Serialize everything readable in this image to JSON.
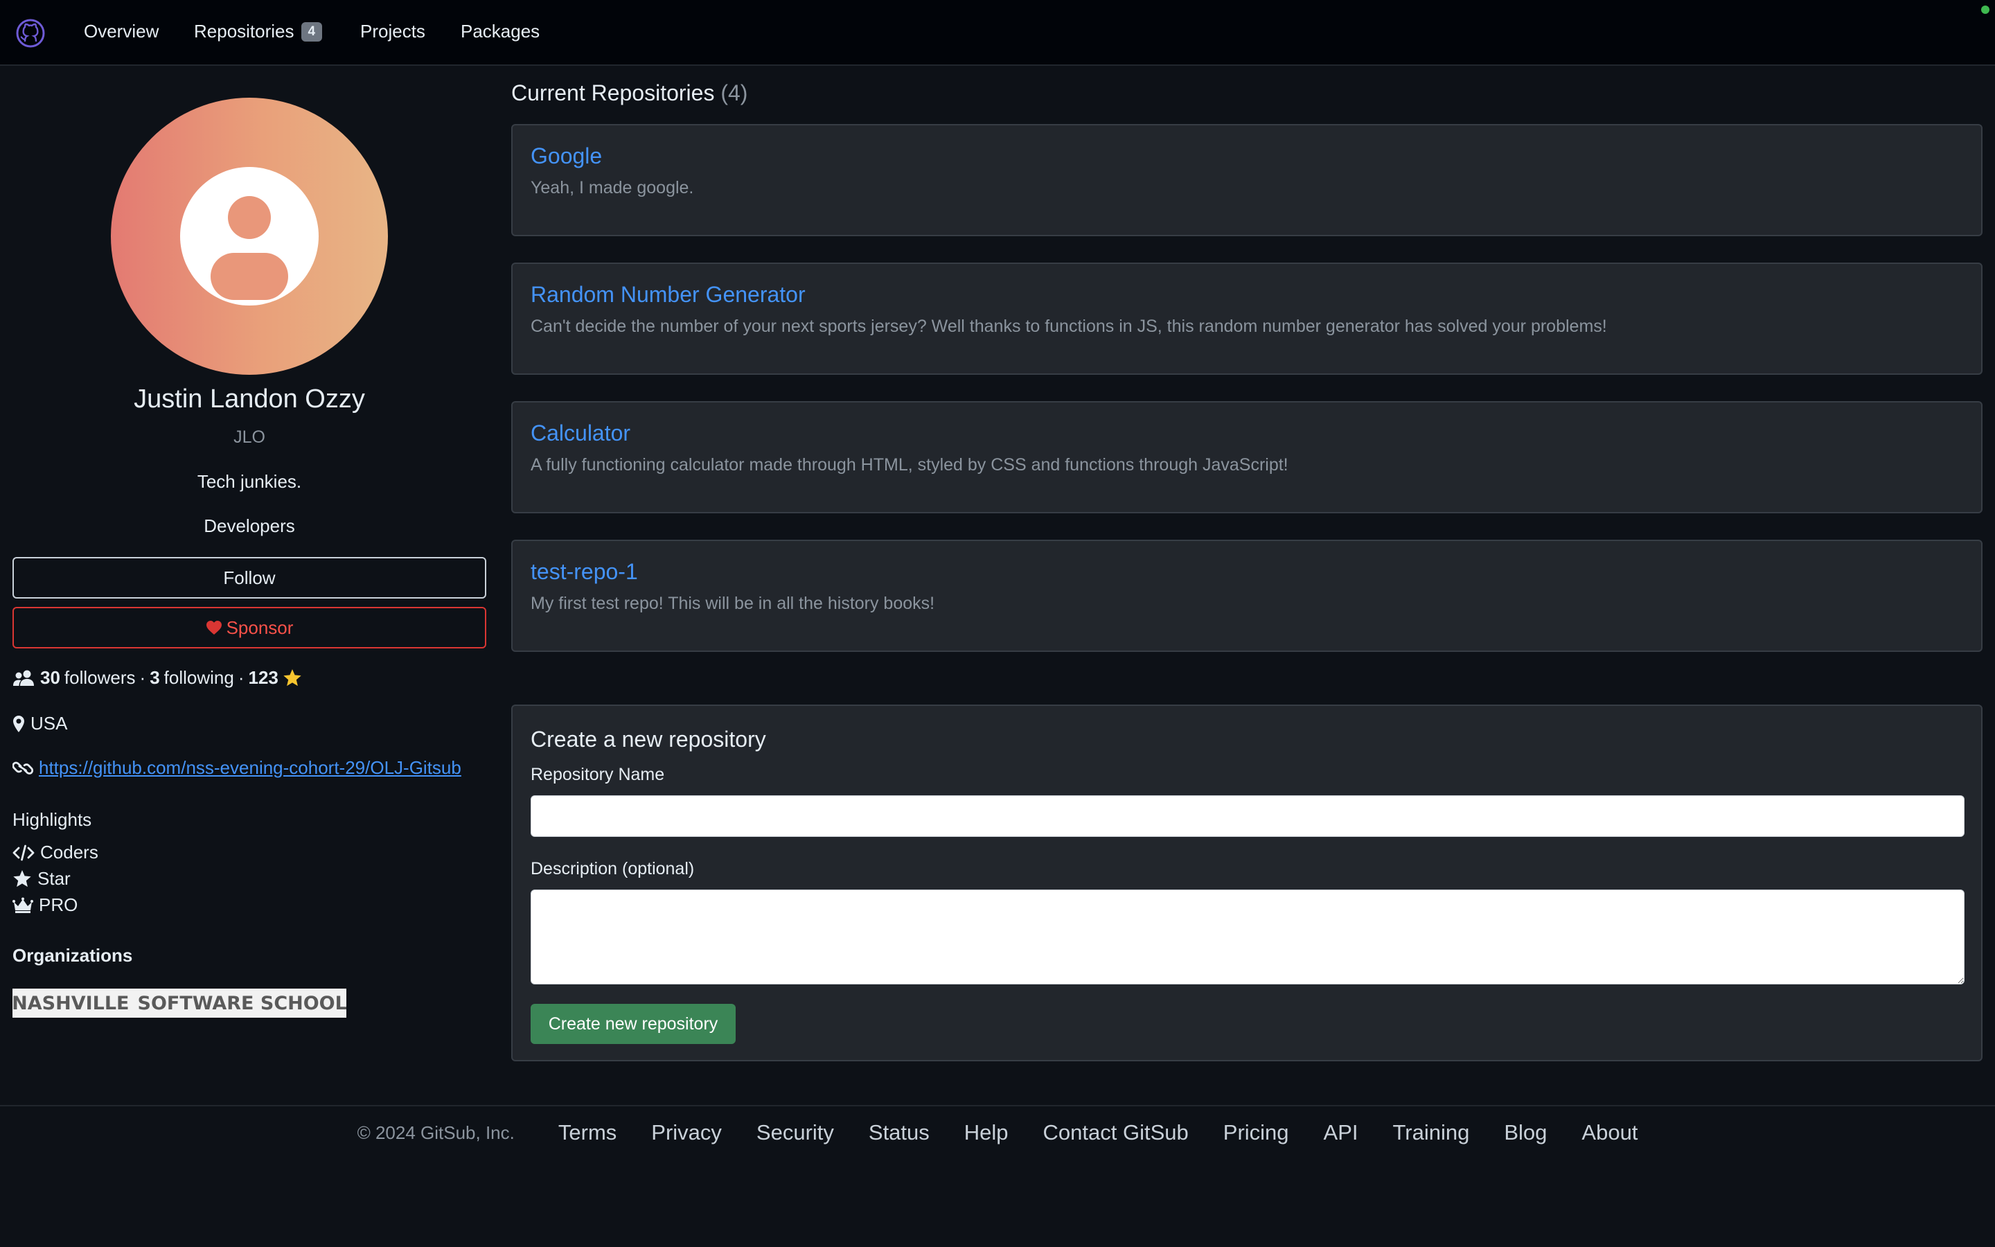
{
  "nav": {
    "items": [
      {
        "label": "Overview"
      },
      {
        "label": "Repositories",
        "badge": "4"
      },
      {
        "label": "Projects"
      },
      {
        "label": "Packages"
      }
    ]
  },
  "profile": {
    "name": "Justin Landon Ozzy",
    "handle": "JLO",
    "tagline": "Tech junkies.",
    "role": "Developers",
    "follow_label": "Follow",
    "sponsor_label": "Sponsor",
    "followers_count": "30",
    "followers_label": "followers",
    "following_count": "3",
    "following_label": "following",
    "stars_count": "123",
    "separator": "·",
    "location": "USA",
    "website": "https://github.com/nss-evening-cohort-29/OLJ-Gitsub"
  },
  "highlights": {
    "title": "Highlights",
    "items": [
      {
        "label": "Coders",
        "icon": "code-icon"
      },
      {
        "label": "Star",
        "icon": "star-icon"
      },
      {
        "label": "PRO",
        "icon": "crown-icon"
      }
    ]
  },
  "organizations": {
    "title": "Organizations",
    "logo_text_left": "NASHVILLE",
    "logo_text_right": "SOFTWARE SCHOOL"
  },
  "repositories": {
    "heading": "Current Repositories",
    "count": "(4)",
    "items": [
      {
        "name": "Google",
        "description": "Yeah, I made google."
      },
      {
        "name": "Random Number Generator",
        "description": "Can't decide the number of your next sports jersey? Well thanks to functions in JS, this random number generator has solved your problems!"
      },
      {
        "name": "Calculator",
        "description": "A fully functioning calculator made through HTML, styled by CSS and functions through JavaScript!"
      },
      {
        "name": "test-repo-1",
        "description": "My first test repo! This will be in all the history books!"
      }
    ]
  },
  "create_form": {
    "title": "Create a new repository",
    "name_label": "Repository Name",
    "name_value": "",
    "description_label": "Description (optional)",
    "description_value": "",
    "submit_label": "Create new repository"
  },
  "footer": {
    "copyright": "© 2024 GitSub, Inc.",
    "links": [
      "Terms",
      "Privacy",
      "Security",
      "Status",
      "Help",
      "Contact GitSub",
      "Pricing",
      "API",
      "Training",
      "Blog",
      "About"
    ]
  },
  "colors": {
    "background": "#0d1117",
    "link": "#4493f8",
    "sponsor": "#f85149",
    "create_button": "#3b8556",
    "status_dot": "#3fb950"
  }
}
